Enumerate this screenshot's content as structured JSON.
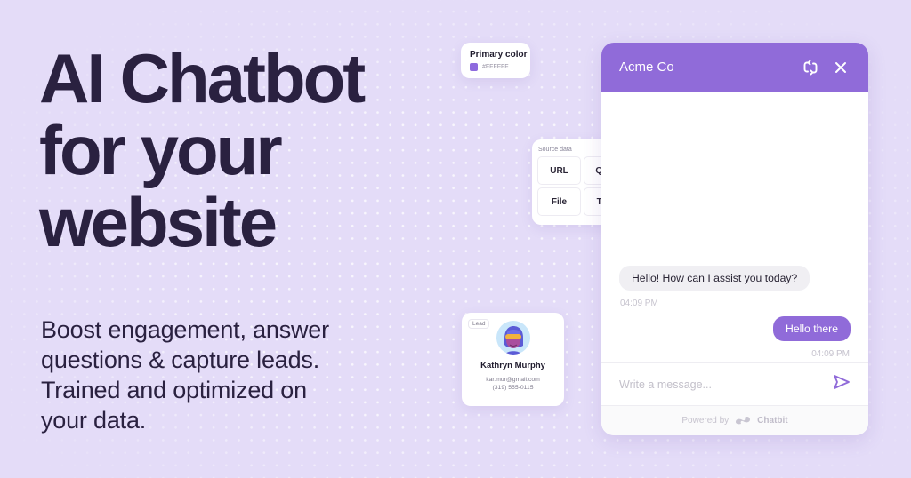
{
  "colors": {
    "background": "#E4DCF8",
    "primary": "#906BD9",
    "headline": "#2A2140",
    "swatch": "#8E6ADE"
  },
  "hero": {
    "headline_lines": [
      "AI Chatbot",
      "for your",
      "website"
    ],
    "subtitle_lines": [
      "Boost engagement, answer",
      "questions & capture leads.",
      "Trained and optimized on",
      "your data."
    ]
  },
  "primary_color_card": {
    "title": "Primary color",
    "value": "#FFFFFF"
  },
  "source_data_card": {
    "title": "Source data",
    "options": [
      "URL",
      "Q&A",
      "File",
      "Text"
    ]
  },
  "lead_card": {
    "badge": "Lead",
    "avatar_icon": "user-avatar-icon",
    "name": "Kathryn Murphy",
    "email": "kar.mur@gmail.com",
    "phone": "(319) 555-0115"
  },
  "chat": {
    "title": "Acme Co",
    "refresh_icon": "refresh-icon",
    "close_icon": "close-icon",
    "messages": [
      {
        "sender": "bot",
        "text": "Hello! How can I assist you today?",
        "time": "04:09 PM"
      },
      {
        "sender": "user",
        "text": "Hello there",
        "time": "04:09 PM"
      }
    ],
    "input_placeholder": "Write a message...",
    "send_icon": "send-icon",
    "footer_prefix": "Powered by",
    "footer_brand": "Chatbit"
  }
}
